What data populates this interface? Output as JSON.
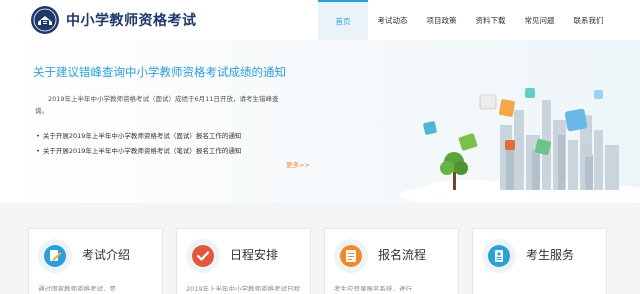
{
  "header": {
    "site_title": "中小学教师资格考试",
    "nav": [
      {
        "label": "首页",
        "active": true
      },
      {
        "label": "考试动态",
        "active": false
      },
      {
        "label": "项目政策",
        "active": false
      },
      {
        "label": "资料下载",
        "active": false
      },
      {
        "label": "常见问题",
        "active": false
      },
      {
        "label": "联系我们",
        "active": false
      }
    ]
  },
  "banner": {
    "title": "关于建议错峰查询中小学教师资格考试成绩的通知",
    "desc_line1": "2019年上半年中小学教师资格考试（面试）成绩于6月11日开放，请考生错峰查",
    "desc_line2": "询。",
    "notices": [
      "关于开展2019年上半年中小学教师资格考试（面试）报名工作的通知",
      "关于开展2019年上半年中小学教师资格考试（笔试）报名工作的通知"
    ],
    "more_label": "更多>>"
  },
  "cards": [
    {
      "title": "考试介绍",
      "icon": "pencil-icon",
      "color": "#2a9fd8",
      "snippet": "通过国家教师资格考试，是"
    },
    {
      "title": "日程安排",
      "icon": "checkmark-icon",
      "color": "#e2583e",
      "snippet": "2019年上半年中小学教师资格考试日程"
    },
    {
      "title": "报名流程",
      "icon": "document-icon",
      "color": "#f08a2a",
      "snippet": "考生应登录报名系统，进行"
    },
    {
      "title": "考生服务",
      "icon": "service-icon",
      "color": "#2a9fd8",
      "snippet": ""
    }
  ],
  "colors": {
    "accent": "#2a9fd8",
    "title_navy": "#1e3a6b",
    "more_orange": "#f08a2a"
  }
}
